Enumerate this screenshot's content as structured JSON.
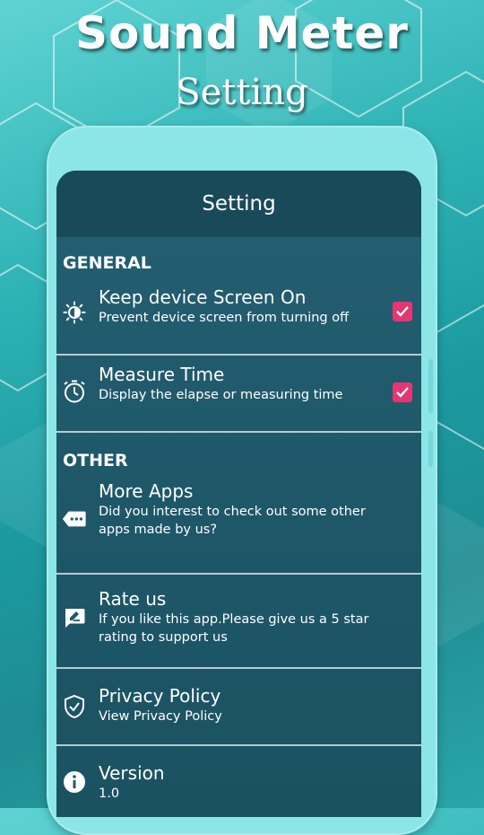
{
  "promo": {
    "title": "Sound Meter",
    "subtitle": "Setting"
  },
  "appbar": {
    "title": "Setting"
  },
  "sections": {
    "general": {
      "header": "GENERAL",
      "items": [
        {
          "title": "Keep device Screen On",
          "subtitle": "Prevent device screen from turning off",
          "icon": "brightness-icon",
          "checked": true
        },
        {
          "title": "Measure Time",
          "subtitle": "Display the elapse or measuring time",
          "icon": "stopwatch-icon",
          "checked": true
        }
      ]
    },
    "other": {
      "header": "OTHER",
      "items": [
        {
          "title": "More Apps",
          "subtitle": "Did you interest to check out some other apps made by us?",
          "icon": "more-apps-icon"
        },
        {
          "title": "Rate us",
          "subtitle": "If you like this app.Please give us a 5 star rating to support us",
          "icon": "rate-icon"
        },
        {
          "title": "Privacy Policy",
          "subtitle": "View Privacy Policy",
          "icon": "shield-check-icon"
        },
        {
          "title": "Version",
          "subtitle": "1.0",
          "icon": "info-icon"
        }
      ]
    }
  },
  "colors": {
    "accent": "#e53672",
    "appbar": "#194a59",
    "screen": "#1f5a6c",
    "phone_frame": "#8ce6e8"
  }
}
